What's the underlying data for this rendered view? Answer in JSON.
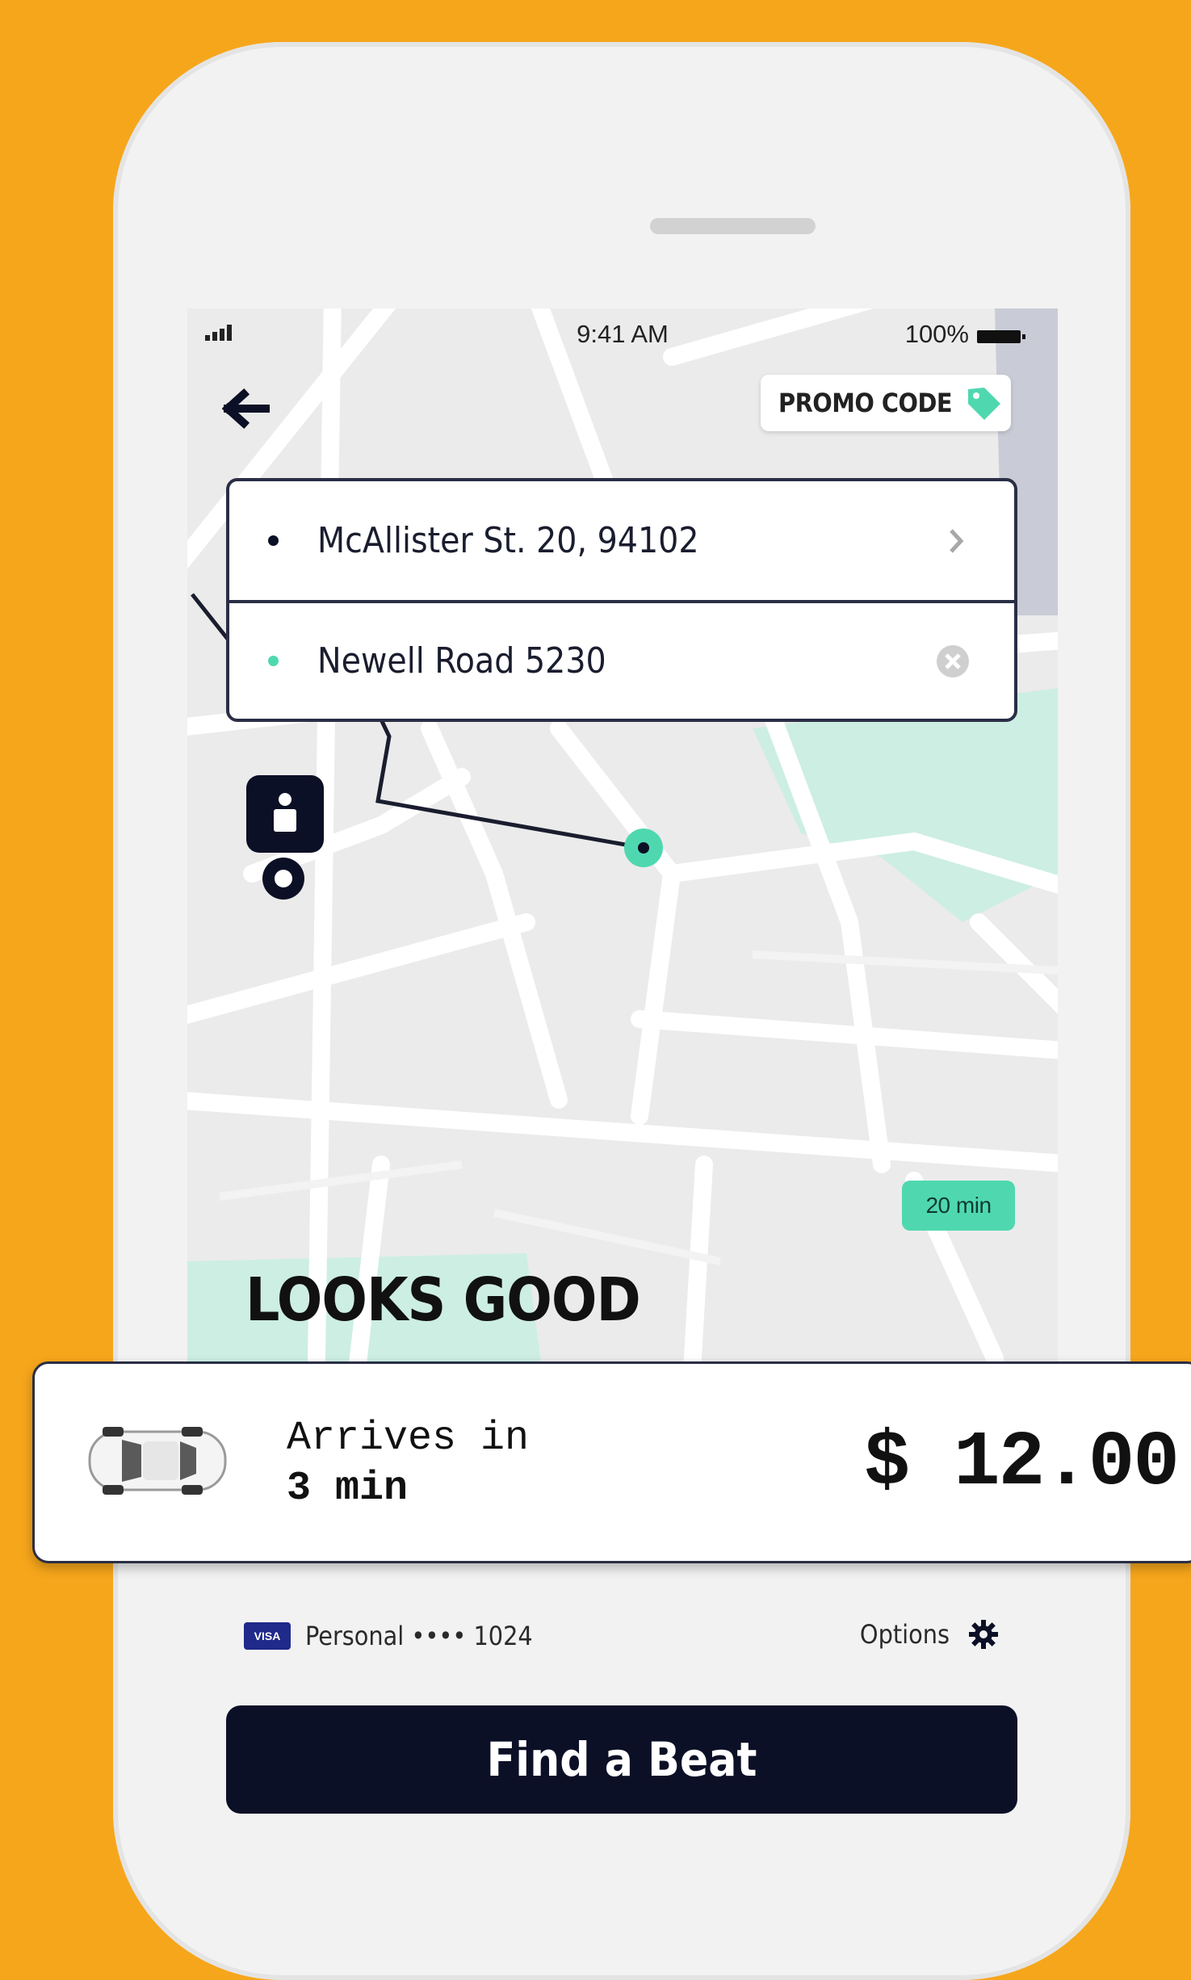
{
  "status_bar": {
    "time": "9:41 AM",
    "battery": "100%"
  },
  "promo": {
    "label": "PROMO CODE"
  },
  "route": {
    "origin": "McAllister St. 20, 94102",
    "destination": "Newell Road 5230"
  },
  "map": {
    "eta_badge": "20 min"
  },
  "headline": "LOOKS GOOD",
  "ride": {
    "arrives_label": "Arrives in",
    "arrives_value": "3 min",
    "price": "$ 12.00"
  },
  "payment": {
    "card_brand": "VISA",
    "label": "Personal •••• 1024",
    "options_label": "Options"
  },
  "cta": {
    "label": "Find a Beat"
  },
  "colors": {
    "background": "#F6A61B",
    "accent": "#4FD8B0",
    "navy": "#0C1026"
  }
}
